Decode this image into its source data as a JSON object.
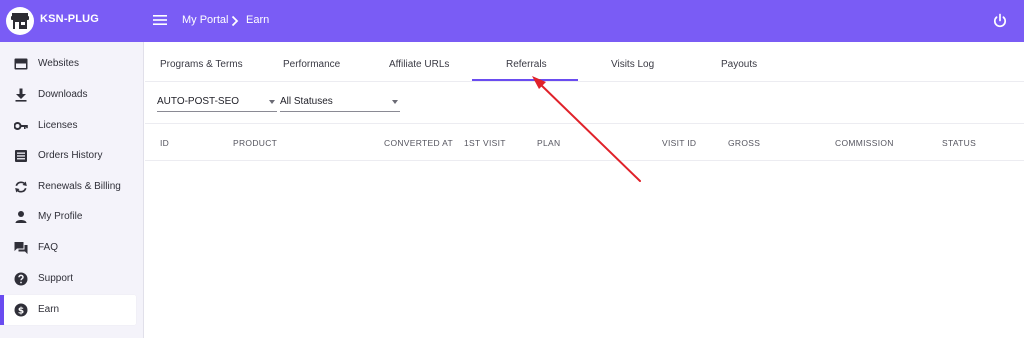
{
  "app": {
    "brand": "KSN-PLUG",
    "colors": {
      "accent": "#7a5cf5",
      "active_indicator": "#6a4cf0",
      "annotation_arrow": "#e0222a"
    }
  },
  "header": {
    "breadcrumb": [
      {
        "label": "My Portal"
      },
      {
        "label": "Earn"
      }
    ],
    "icons": [
      "menu-icon",
      "chevron-right-icon",
      "power-icon"
    ]
  },
  "sidebar": {
    "items": [
      {
        "label": "Websites",
        "icon": "browser-window-icon",
        "active": false
      },
      {
        "label": "Downloads",
        "icon": "download-icon",
        "active": false
      },
      {
        "label": "Licenses",
        "icon": "key-icon",
        "active": false
      },
      {
        "label": "Orders History",
        "icon": "receipt-icon",
        "active": false
      },
      {
        "label": "Renewals & Billing",
        "icon": "refresh-icon",
        "active": false
      },
      {
        "label": "My Profile",
        "icon": "person-icon",
        "active": false
      },
      {
        "label": "FAQ",
        "icon": "chat-bubbles-icon",
        "active": false
      },
      {
        "label": "Support",
        "icon": "help-circle-icon",
        "active": false
      },
      {
        "label": "Earn",
        "icon": "dollar-circle-icon",
        "active": true
      }
    ]
  },
  "main": {
    "tabs": [
      {
        "label": "Programs & Terms",
        "active": false
      },
      {
        "label": "Performance",
        "active": false
      },
      {
        "label": "Affiliate URLs",
        "active": false
      },
      {
        "label": "Referrals",
        "active": true
      },
      {
        "label": "Visits Log",
        "active": false
      },
      {
        "label": "Payouts",
        "active": false
      }
    ],
    "filters": {
      "program": {
        "value": "AUTO-POST-SEO"
      },
      "status": {
        "value": "All Statuses"
      }
    },
    "table": {
      "columns": [
        "ID",
        "PRODUCT",
        "CONVERTED AT",
        "1ST VISIT",
        "PLAN",
        "VISIT ID",
        "GROSS",
        "COMMISSION",
        "STATUS"
      ],
      "rows": []
    }
  }
}
